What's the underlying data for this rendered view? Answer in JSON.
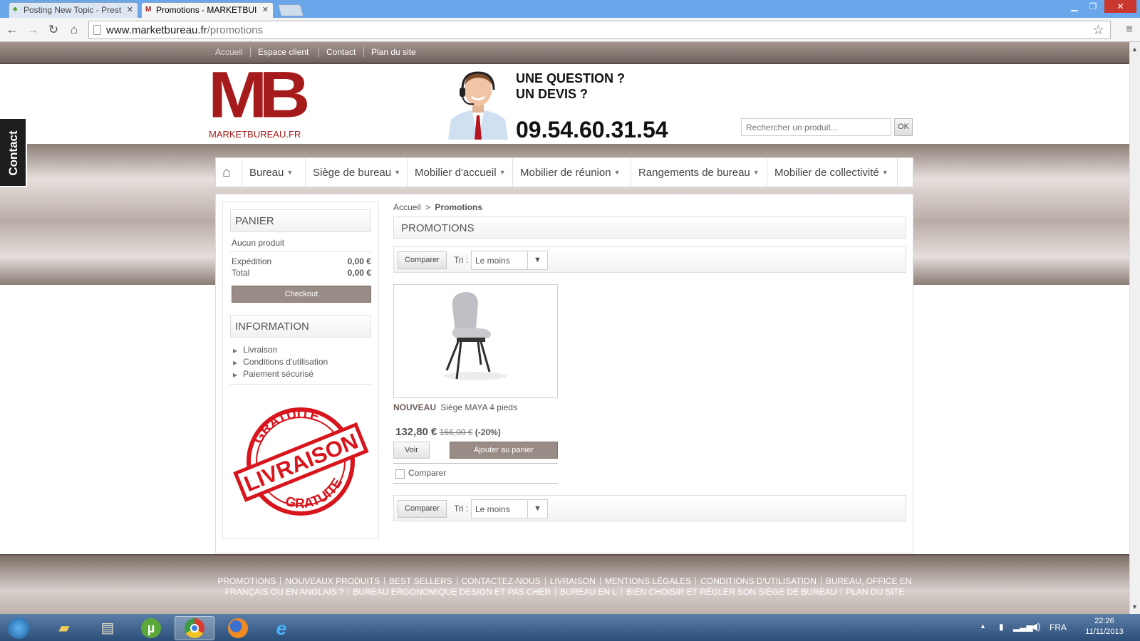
{
  "browser": {
    "tabs": [
      {
        "title": "Posting New Topic - Prest",
        "active": false
      },
      {
        "title": "Promotions - MARKETBUI",
        "active": true
      }
    ],
    "url_host": "www.marketbureau.fr",
    "url_path": "/promotions"
  },
  "topnav": [
    "Accueil",
    "Espace client",
    "Contact",
    "Plan du site"
  ],
  "contact_tab": "Contact",
  "header": {
    "logo_text": "MB",
    "logo_subtext": "MARKETBUREAU.FR",
    "question_line1": "UNE QUESTION ?",
    "question_line2": "UN DEVIS ?",
    "phone": "09.54.60.31.54",
    "search_placeholder": "Rechercher un produit...",
    "search_button": "OK"
  },
  "menu": [
    "Bureau",
    "Siège de bureau",
    "Mobilier d'accueil",
    "Mobilier de réunion",
    "Rangements de bureau",
    "Mobilier de collectivité"
  ],
  "cart": {
    "title": "PANIER",
    "empty": "Aucun produit",
    "shipping_label": "Expédition",
    "shipping_value": "0,00 €",
    "total_label": "Total",
    "total_value": "0,00 €",
    "checkout": "Checkout"
  },
  "info": {
    "title": "INFORMATION",
    "links": [
      "Livraison",
      "Conditions d'utilisation",
      "Paiement sécurisé"
    ]
  },
  "promo_stamp": {
    "top": "GRATUITE",
    "middle": "LIVRAISON",
    "bottom": "GRATUITE"
  },
  "breadcrumb": {
    "home": "Accueil",
    "sep": ">",
    "current": "Promotions"
  },
  "page_title": "PROMOTIONS",
  "sort": {
    "compare": "Comparer",
    "label": "Tri :",
    "value": "Le moins"
  },
  "product": {
    "badge": "NOUVEAU",
    "name": "Siège MAYA 4 pieds",
    "price": "132,80 €",
    "old_price": "166,00 €",
    "discount": "(-20%)",
    "view": "Voir",
    "add_to_cart": "Ajouter au panier",
    "compare": "Comparer"
  },
  "footer_links_row1": [
    "PROMOTIONS",
    "NOUVEAUX PRODUITS",
    "BEST SELLERS",
    "CONTACTEZ-NOUS",
    "LIVRAISON",
    "MENTIONS LÉGALES",
    "CONDITIONS D'UTILISATION",
    "BUREAU, OFFICE EN"
  ],
  "footer_links_row2": [
    "FRANÇAIS OU EN ANGLAIS ?",
    "BUREAU ERGONOMIQUE DESIGN ET PAS CHER",
    "BUREAU EN L",
    "BIEN CHOISIR ET RÉGLER SON SIÈGE DE BUREAU",
    "PLAN DU SITE"
  ],
  "taskbar": {
    "lang": "FRA",
    "time": "22:26",
    "date": "11/11/2013"
  }
}
